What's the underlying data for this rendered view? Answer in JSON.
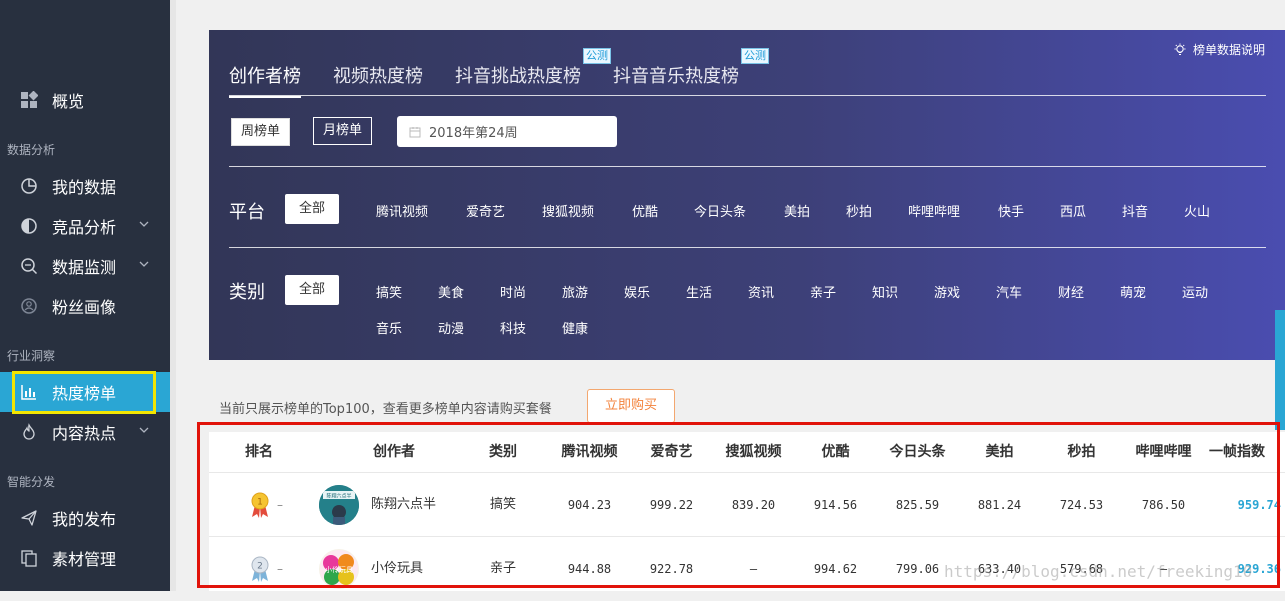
{
  "sidebar": {
    "overview": "概览",
    "groups": [
      "数据分析",
      "行业洞察",
      "智能分发"
    ],
    "items": [
      {
        "label": "我的数据",
        "icon": "pie-chart-icon",
        "chevron": false
      },
      {
        "label": "竞品分析",
        "icon": "compare-icon",
        "chevron": true
      },
      {
        "label": "数据监测",
        "icon": "monitor-search-icon",
        "chevron": true
      },
      {
        "label": "粉丝画像",
        "icon": "fans-profile-icon",
        "chevron": false
      },
      {
        "label": "热度榜单",
        "icon": "bar-chart-icon",
        "chevron": false,
        "active": true
      },
      {
        "label": "内容热点",
        "icon": "flame-icon",
        "chevron": true
      },
      {
        "label": "我的发布",
        "icon": "send-icon",
        "chevron": false
      },
      {
        "label": "素材管理",
        "icon": "materials-icon",
        "chevron": false
      }
    ]
  },
  "tabs": [
    {
      "label": "创作者榜",
      "active": true,
      "beta": ""
    },
    {
      "label": "视频热度榜",
      "active": false,
      "beta": ""
    },
    {
      "label": "抖音挑战热度榜",
      "active": false,
      "beta": "公测"
    },
    {
      "label": "抖音音乐热度榜",
      "active": false,
      "beta": "公测"
    }
  ],
  "help_label": "榜单数据说明",
  "period": {
    "weekly": "周榜单",
    "monthly": "月榜单",
    "date_value": "2018年第24周"
  },
  "platform": {
    "label": "平台",
    "all": "全部",
    "options": [
      "腾讯视频",
      "爱奇艺",
      "搜狐视频",
      "优酷",
      "今日头条",
      "美拍",
      "秒拍",
      "哔哩哔哩",
      "快手",
      "西瓜",
      "抖音",
      "火山"
    ]
  },
  "category": {
    "label": "类别",
    "all": "全部",
    "options_row1": [
      "搞笑",
      "美食",
      "时尚",
      "旅游",
      "娱乐",
      "生活",
      "资讯",
      "亲子",
      "知识",
      "游戏",
      "汽车",
      "财经",
      "萌宠",
      "运动"
    ],
    "options_row2": [
      "音乐",
      "动漫",
      "科技",
      "健康"
    ]
  },
  "notice": {
    "text": "当前只展示榜单的Top100，查看更多榜单内容请购买套餐",
    "buy_label": "立即购买"
  },
  "table": {
    "headers": [
      "排名",
      "创作者",
      "类别",
      "腾讯视频",
      "爱奇艺",
      "搜狐视频",
      "优酷",
      "今日头条",
      "美拍",
      "秒拍",
      "哔哩哔哩",
      "一帧指数"
    ],
    "rows": [
      {
        "rank": "1",
        "change": "–",
        "avatar_text": "陈翔六点半",
        "name": "陈翔六点半",
        "category": "搞笑",
        "values": [
          "904.23",
          "999.22",
          "839.20",
          "914.56",
          "825.59",
          "881.24",
          "724.53",
          "786.50"
        ],
        "index": "959.74"
      },
      {
        "rank": "2",
        "change": "–",
        "avatar_text": "小伶玩具",
        "name": "小伶玩具",
        "category": "亲子",
        "values": [
          "944.88",
          "922.78",
          "–",
          "994.62",
          "799.06",
          "633.40",
          "579.68",
          "–"
        ],
        "index": "929.36"
      }
    ]
  },
  "watermark": "https://blog.csdn.net/freeking10",
  "colors": {
    "sidebar": "#28303f",
    "active": "#2aa6d4",
    "highlight_box": "#f3e500",
    "annotation_box": "#e1130a",
    "buy": "#f3833c"
  }
}
